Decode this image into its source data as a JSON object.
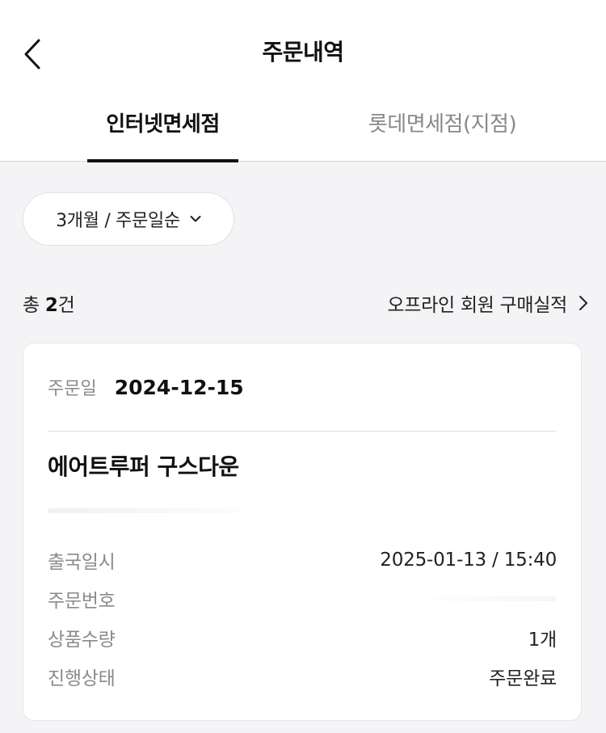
{
  "header": {
    "title": "주문내역",
    "back_icon": "chevron-left-icon"
  },
  "tabs": [
    {
      "label": "인터넷면세점",
      "active": true
    },
    {
      "label": "롯데면세점(지점)",
      "active": false
    }
  ],
  "filter": {
    "label": "3개월 / 주문일순",
    "icon": "chevron-down-icon"
  },
  "summary": {
    "count_prefix": "총 ",
    "count_value": "2",
    "count_suffix": "건",
    "offline_link": "오프라인 회원 구매실적"
  },
  "order": {
    "date_label": "주문일",
    "date_value": "2024-12-15",
    "product_name": "에어트루퍼 구스다운",
    "details": [
      {
        "label": "출국일시",
        "value": "2025-01-13 / 15:40"
      },
      {
        "label": "주문번호",
        "value": ""
      },
      {
        "label": "상품수량",
        "value": "1개"
      },
      {
        "label": "진행상태",
        "value": "주문완료"
      }
    ]
  },
  "colors": {
    "background": "#f4f4f6",
    "card": "#ffffff",
    "text_primary": "#111111",
    "text_secondary": "#8a8a8a",
    "tab_inactive": "#888888"
  }
}
